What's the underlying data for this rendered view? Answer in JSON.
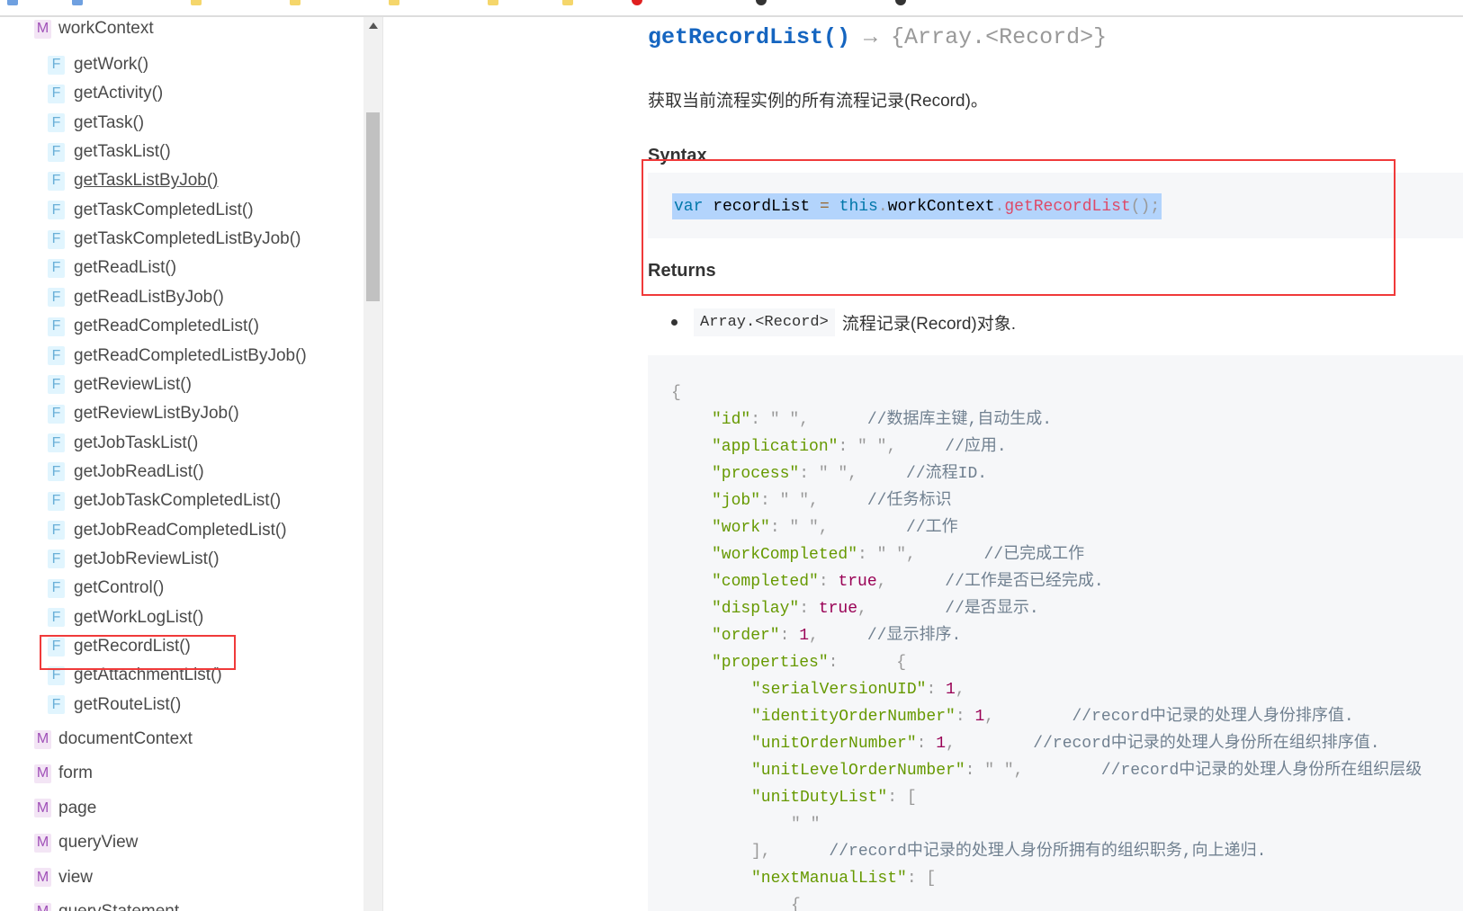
{
  "sidebar": {
    "groups_top": {
      "badge": "M",
      "label": "workContext"
    },
    "functions": [
      {
        "badge": "F",
        "label": "getWork()"
      },
      {
        "badge": "F",
        "label": "getActivity()"
      },
      {
        "badge": "F",
        "label": "getTask()"
      },
      {
        "badge": "F",
        "label": "getTaskList()"
      },
      {
        "badge": "F",
        "label": "getTaskListByJob()",
        "hover": true
      },
      {
        "badge": "F",
        "label": "getTaskCompletedList()"
      },
      {
        "badge": "F",
        "label": "getTaskCompletedListByJob()"
      },
      {
        "badge": "F",
        "label": "getReadList()"
      },
      {
        "badge": "F",
        "label": "getReadListByJob()"
      },
      {
        "badge": "F",
        "label": "getReadCompletedList()"
      },
      {
        "badge": "F",
        "label": "getReadCompletedListByJob()"
      },
      {
        "badge": "F",
        "label": "getReviewList()"
      },
      {
        "badge": "F",
        "label": "getReviewListByJob()"
      },
      {
        "badge": "F",
        "label": "getJobTaskList()"
      },
      {
        "badge": "F",
        "label": "getJobReadList()"
      },
      {
        "badge": "F",
        "label": "getJobTaskCompletedList()"
      },
      {
        "badge": "F",
        "label": "getJobReadCompletedList()"
      },
      {
        "badge": "F",
        "label": "getJobReviewList()"
      },
      {
        "badge": "F",
        "label": "getControl()"
      },
      {
        "badge": "F",
        "label": "getWorkLogList()"
      },
      {
        "badge": "F",
        "label": "getRecordList()",
        "selected": true
      },
      {
        "badge": "F",
        "label": "getAttachmentList()"
      },
      {
        "badge": "F",
        "label": "getRouteList()"
      }
    ],
    "modules": [
      {
        "badge": "M",
        "label": "documentContext"
      },
      {
        "badge": "M",
        "label": "form"
      },
      {
        "badge": "M",
        "label": "page"
      },
      {
        "badge": "M",
        "label": "queryView"
      },
      {
        "badge": "M",
        "label": "view"
      },
      {
        "badge": "M",
        "label": "queryStatement"
      }
    ]
  },
  "main": {
    "title": "getRecordList()",
    "return_sig": " → {Array.<Record>}",
    "description": "获取当前流程实例的所有流程记录(Record)。",
    "syntax_heading": "Syntax",
    "syntax_code": {
      "kw1": "var",
      "name": " recordList ",
      "op": "=",
      "kw2": " this",
      "dot1": ".",
      "obj": "workContext",
      "dot2": ".",
      "fn": "getRecordList",
      "parens": "();"
    },
    "returns_heading": "Returns",
    "returns": {
      "type": "Array.<Record>",
      "text": "流程记录(Record)对象."
    },
    "example_lines": [
      {
        "lvl": 0,
        "p": "{"
      },
      {
        "lvl": 1,
        "k": "\"id\"",
        "p": ": \" \",",
        "c": "//数据库主键,自动生成.",
        "sp": 6
      },
      {
        "lvl": 1,
        "k": "\"application\"",
        "p": ": \" \",",
        "c": "//应用.",
        "sp": 5
      },
      {
        "lvl": 1,
        "k": "\"process\"",
        "p": ": \" \",",
        "c": "//流程ID.",
        "sp": 5
      },
      {
        "lvl": 1,
        "k": "\"job\"",
        "p": ": \" \",",
        "c": "//任务标识",
        "sp": 5
      },
      {
        "lvl": 1,
        "k": "\"work\"",
        "p": ": \" \",",
        "c": "//工作",
        "sp": 8
      },
      {
        "lvl": 1,
        "k": "\"workCompleted\"",
        "p": ": \" \",",
        "c": "//已完成工作",
        "sp": 7
      },
      {
        "lvl": 1,
        "k": "\"completed\"",
        "p": ": ",
        "v": "true",
        "p2": ",",
        "c": "//工作是否已经完成.",
        "sp": 6
      },
      {
        "lvl": 1,
        "k": "\"display\"",
        "p": ": ",
        "v": "true",
        "p2": ",",
        "c": "//是否显示.",
        "sp": 8
      },
      {
        "lvl": 1,
        "k": "\"order\"",
        "p": ": ",
        "v": "1",
        "p2": ",",
        "c": "//显示排序.",
        "sp": 5
      },
      {
        "lvl": 1,
        "k": "\"properties\"",
        "p": ":      {"
      },
      {
        "lvl": 2,
        "k": "\"serialVersionUID\"",
        "p": ": ",
        "v": "1",
        "p2": ","
      },
      {
        "lvl": 2,
        "k": "\"identityOrderNumber\"",
        "p": ": ",
        "v": "1",
        "p2": ",",
        "c": "//record中记录的处理人身份排序值.",
        "sp": 8
      },
      {
        "lvl": 2,
        "k": "\"unitOrderNumber\"",
        "p": ": ",
        "v": "1",
        "p2": ",",
        "c": "//record中记录的处理人身份所在组织排序值.",
        "sp": 8
      },
      {
        "lvl": 2,
        "k": "\"unitLevelOrderNumber\"",
        "p": ": \" \",",
        "c": "//record中记录的处理人身份所在组织层级",
        "sp": 8
      },
      {
        "lvl": 2,
        "k": "\"unitDutyList\"",
        "p": ": ["
      },
      {
        "lvl": 3,
        "p": "\" \""
      },
      {
        "lvl": 2,
        "p": "],",
        "c": "//record中记录的处理人身份所拥有的组织职务,向上递归.",
        "sp": 6
      },
      {
        "lvl": 2,
        "k": "\"nextManualList\"",
        "p": ": ["
      },
      {
        "lvl": 3,
        "p": "{"
      }
    ]
  },
  "colors": {
    "accent": "#1565c0",
    "highlight": "#f03a3a",
    "selection": "#b3d4fc"
  }
}
